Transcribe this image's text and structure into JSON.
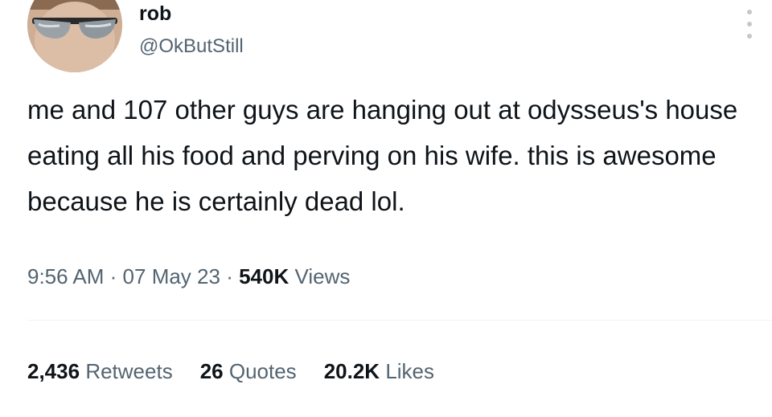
{
  "author": {
    "name": "rob",
    "handle": "@OkButStill"
  },
  "tweet": {
    "text": "me and 107 other guys are hanging out at odysseus's house eating all his food and perving on his wife. this is awesome because he is certainly dead lol.",
    "time": "9:56 AM",
    "date": "07 May 23",
    "separator": "·",
    "views_count": "540K",
    "views_label": "Views"
  },
  "stats": {
    "retweets_count": "2,436",
    "retweets_label": "Retweets",
    "quotes_count": "26",
    "quotes_label": "Quotes",
    "likes_count": "20.2K",
    "likes_label": "Likes"
  },
  "icons": {
    "avatar": "profile-photo",
    "more": "more-options-icon"
  },
  "colors": {
    "text_primary": "#0f1419",
    "text_secondary": "#536471",
    "divider": "#eff3f4"
  }
}
